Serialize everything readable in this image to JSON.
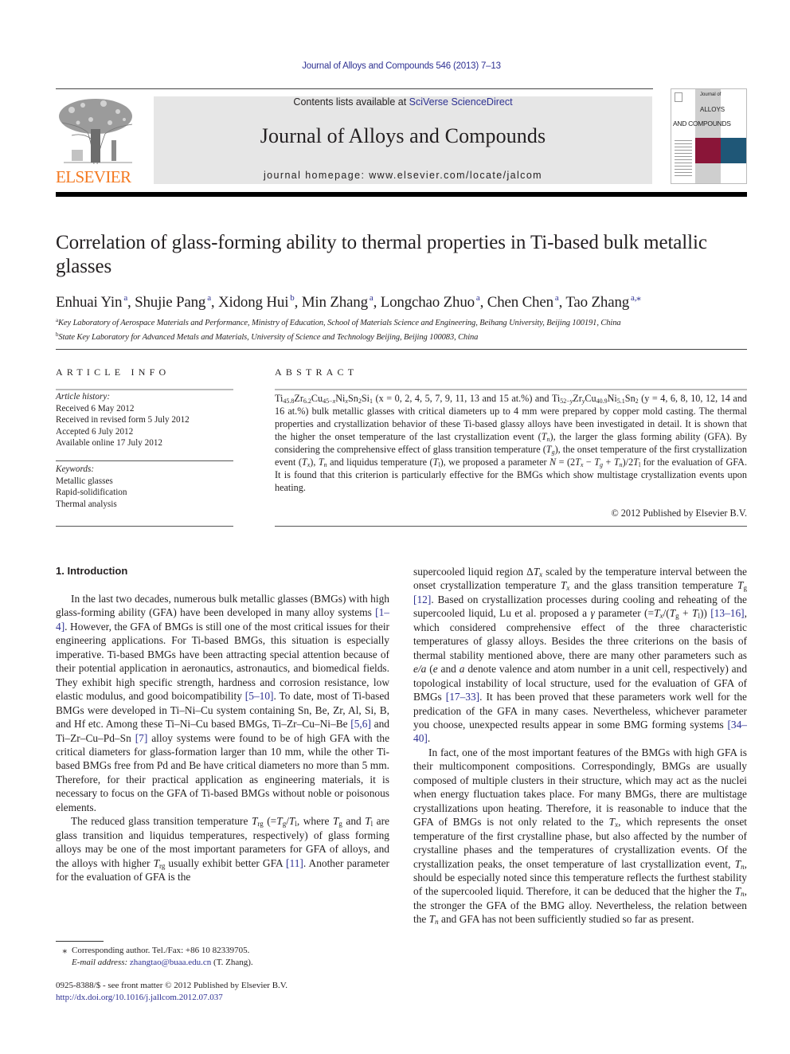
{
  "running_head": "Journal of Alloys and Compounds 546 (2013) 7–13",
  "masthead": {
    "publisher_logo_text": "ELSEVIER",
    "contents_prefix": "Contents lists available at ",
    "contents_link": "SciVerse ScienceDirect",
    "journal_name": "Journal of Alloys and Compounds",
    "homepage_prefix": "journal homepage: ",
    "homepage_url": "www.elsevier.com/locate/jalcom",
    "cover": {
      "line1": "Journal of",
      "line2": "ALLOYS",
      "line3": "AND COMPOUNDS",
      "accent_red": "#8a1538",
      "accent_blue": "#1f5777"
    },
    "logo_color": "#f47920"
  },
  "article": {
    "title": "Correlation of glass-forming ability to thermal properties in Ti-based bulk metallic glasses",
    "authors": [
      {
        "name": "Enhuai Yin",
        "aff": "a"
      },
      {
        "name": "Shujie Pang",
        "aff": "a"
      },
      {
        "name": "Xidong Hui",
        "aff": "b"
      },
      {
        "name": "Min Zhang",
        "aff": "a"
      },
      {
        "name": "Longchao Zhuo",
        "aff": "a"
      },
      {
        "name": "Chen Chen",
        "aff": "a"
      },
      {
        "name": "Tao Zhang",
        "aff": "a,⁎"
      }
    ],
    "affiliations": [
      {
        "mark": "a",
        "text": "Key Laboratory of Aerospace Materials and Performance, Ministry of Education, School of Materials Science and Engineering, Beihang University, Beijing 100191, China"
      },
      {
        "mark": "b",
        "text": "State Key Laboratory for Advanced Metals and Materials, University of Science and Technology Beijing, Beijing 100083, China"
      }
    ]
  },
  "article_info": {
    "heading": "ARTICLE INFO",
    "history_label": "Article history:",
    "history": [
      "Received 6 May 2012",
      "Received in revised form 5 July 2012",
      "Accepted 6 July 2012",
      "Available online 17 July 2012"
    ],
    "keywords_label": "Keywords:",
    "keywords": [
      "Metallic glasses",
      "Rapid-solidification",
      "Thermal analysis"
    ]
  },
  "abstract": {
    "heading": "ABSTRACT",
    "copyright": "© 2012 Published by Elsevier B.V.",
    "t1": " (x = 0, 2, 4, 5, 7, 9, 11, 13 and 15 at.%) and ",
    "t2": " (y = 4, 6, 8, 10, 12, 14 and 16 at.%) bulk metallic glasses with critical diameters up to 4 mm were prepared by copper mold casting. The thermal properties and crystallization behavior of these Ti-based glassy alloys have been investigated in detail. It is shown that the higher the onset temperature of the last crystallization event (",
    "t3": "), the larger the glass forming ability (GFA). By considering the comprehensive effect of glass transition temperature (",
    "t4": "), the onset temperature of the first crystallization event (",
    "t5": " and liquidus temperature (",
    "t6": "), we proposed a parameter ",
    "t7": " for the evaluation of GFA. It is found that this criterion is particularly effective for the BMGs which show multistage crystallization events upon heating."
  },
  "intro": {
    "heading": "1. Introduction",
    "p1": {
      "a": "In the last two decades, numerous bulk metallic glasses (BMGs) with high glass-forming ability (GFA) have been developed in many alloy systems ",
      "r1": "[1–4]",
      "b": ". However, the GFA of BMGs is still one of the most critical issues for their engineering applications. For Ti-based BMGs, this situation is especially imperative. Ti-based BMGs have been attracting special attention because of their potential application in aeronautics, astronautics, and biomedical fields. They exhibit high specific strength, hardness and corrosion resistance, low elastic modulus, and good boicompatibility ",
      "r2": "[5–10]",
      "c": ". To date, most of Ti-based BMGs were developed in Ti–Ni–Cu system containing Sn, Be, Zr, Al, Si, B, and Hf etc. Among these Ti–Ni–Cu based BMGs, Ti–Zr–Cu–Ni–Be ",
      "r3": "[5,6]",
      "d": " and Ti–Zr–Cu–Pd–Sn ",
      "r4": "[7]",
      "e": " alloy systems were found to be of high GFA with the critical diameters for glass-formation larger than 10 mm, while the other Ti-based BMGs free from Pd and Be have critical diameters no more than 5 mm. Therefore, for their practical application as engineering materials, it is necessary to focus on the GFA of Ti-based BMGs without noble or poisonous elements."
    },
    "p2": {
      "a": "The reduced glass transition temperature ",
      "b": " (=",
      "c": ", where ",
      "d": " and ",
      "e": " are glass transition and liquidus temperatures, respectively) of glass forming alloys may be one of the most important parameters for GFA of alloys, and the alloys with higher ",
      "f": " usually exhibit better GFA ",
      "r1": "[11]",
      "g": ". Another parameter for the evaluation of GFA is the"
    },
    "p3": {
      "a": "supercooled liquid region ",
      "b": " scaled by the temperature interval between the onset crystallization temperature ",
      "c": " and the glass transition temperature ",
      "r1": "[12]",
      "d": ". Based on crystallization processes during cooling and reheating of the supercooled liquid, Lu et al. proposed a ",
      "e": " parameter (=",
      "r2": "[13–16]",
      "f": ", which considered comprehensive effect of the three characteristic temperatures of glassy alloys. Besides the three criterions on the basis of thermal stability mentioned above, there are many other parameters such as ",
      "g": " (",
      "h": " and ",
      "i": " denote valence and atom number in a unit cell, respectively) and topological instability of local structure, used for the evaluation of GFA of BMGs ",
      "r3": "[17–33]",
      "j": ". It has been proved that these parameters work well for the predication of the GFA in many cases. Nevertheless, whichever parameter you choose, unexpected results appear in some BMG forming systems ",
      "r4": "[34–40]",
      "k": "."
    },
    "p4": {
      "a": "In fact, one of the most important features of the BMGs with high GFA is their multicomponent compositions. Correspondingly, BMGs are usually composed of multiple clusters in their structure, which may act as the nuclei when energy fluctuation takes place. For many BMGs, there are multistage crystallizations upon heating. Therefore, it is reasonable to induce that the GFA of BMGs is not only related to the ",
      "b": ", which represents the onset temperature of the first crystalline phase, but also affected by the number of crystalline phases and the temperatures of crystallization events. Of the crystallization peaks, the onset temperature of last crystallization event, ",
      "c": ", should be especially noted since this temperature reflects the furthest stability of the supercooled liquid. Therefore, it can be deduced that the higher the ",
      "d": ", the stronger the GFA of the BMG alloy. Nevertheless, the relation between the ",
      "e": " and GFA has not been sufficiently studied so far as present."
    }
  },
  "footnote": {
    "star": "⁎",
    "corresponding": "Corresponding author. Tel./Fax: +86 10 82339705.",
    "email_label": "E-mail address: ",
    "email": "zhangtao@buaa.edu.cn",
    "email_suffix": " (T. Zhang).",
    "issn": "0925-8388/$ - see front matter © 2012 Published by Elsevier B.V.",
    "doi": "http://dx.doi.org/10.1016/j.jallcom.2012.07.037"
  },
  "colors": {
    "link": "#2e3192",
    "text": "#231f20",
    "masthead_bg": "#e6e6e6"
  }
}
